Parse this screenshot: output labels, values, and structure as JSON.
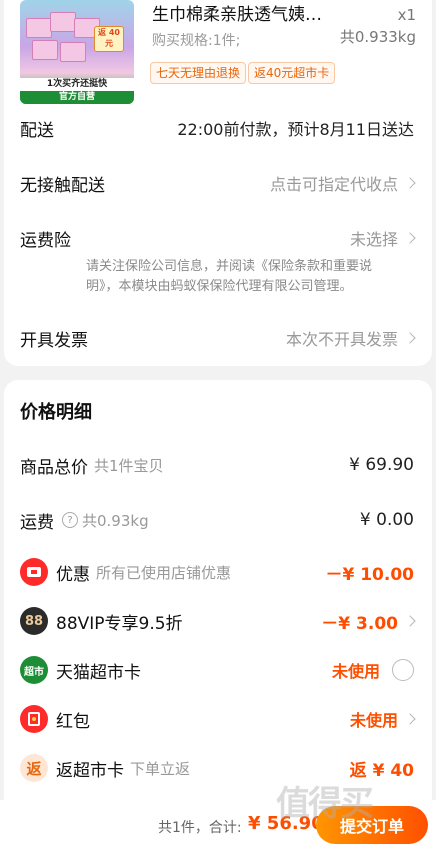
{
  "product": {
    "title": "生巾棉柔亲肤透气姨…",
    "quantity": "x1",
    "spec": "购买规格:1件;",
    "weight": "共0.933kg",
    "tags": [
      "七天无理由退换",
      "返40元超市卡"
    ],
    "image_banner_1": "1次买齐还挺快",
    "image_banner_2": "官方自营",
    "image_badge": "返 40 元"
  },
  "delivery": {
    "label": "配送",
    "value": "22:00前付款，预计8月11日送达"
  },
  "contactless": {
    "label": "无接触配送",
    "value": "点击可指定代收点"
  },
  "shipping_insurance": {
    "label": "运费险",
    "value": "未选择",
    "note": "请关注保险公司信息，并阅读《保险条款和重要说明》，本模块由蚂蚁保保险代理有限公司管理。"
  },
  "invoice": {
    "label": "开具发票",
    "value": "本次不开具发票"
  },
  "price_detail": {
    "title": "价格明细",
    "subtotal": {
      "label": "商品总价",
      "sub": "共1件宝贝",
      "amount": "¥ 69.90"
    },
    "freight": {
      "label": "运费",
      "sub": "共0.93kg",
      "amount": "¥ 0.00"
    },
    "discount": {
      "label": "优惠",
      "sub": "所有已使用店铺优惠",
      "amount": "－¥ 10.00"
    },
    "vip": {
      "label": "88VIP专享9.5折",
      "amount": "－¥ 3.00",
      "icon_text": "88"
    },
    "tmall_card": {
      "label": "天猫超市卡",
      "status": "未使用",
      "icon_text": "超市"
    },
    "red_packet": {
      "label": "红包",
      "status": "未使用"
    },
    "cashback": {
      "label": "返超市卡",
      "sub": "下单立返",
      "amount": "返 ¥ 40",
      "icon_text": "返"
    }
  },
  "footer": {
    "total_label": "共1件，合计:",
    "total_value": "¥ 56.90",
    "submit_label": "提交订单"
  },
  "watermark": "值得买",
  "colors": {
    "accent": "#ff5000",
    "tag_text": "#e8670e",
    "tmall_green": "#1e8e36"
  }
}
